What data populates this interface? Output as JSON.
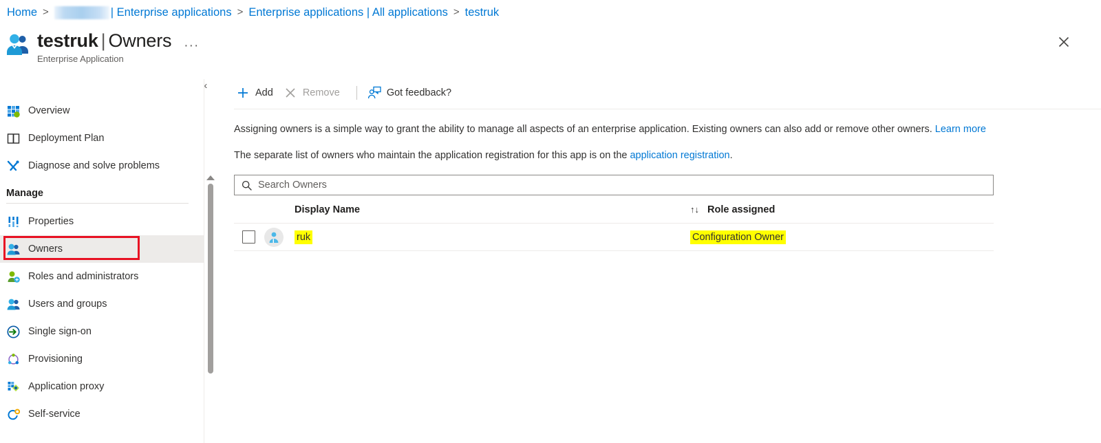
{
  "breadcrumb": {
    "items": [
      {
        "label": "Home",
        "type": "link"
      },
      {
        "label": "",
        "type": "redacted"
      },
      {
        "label": "| Enterprise applications",
        "type": "link"
      },
      {
        "label": "Enterprise applications | All applications",
        "type": "link"
      },
      {
        "label": "testruk",
        "type": "link"
      }
    ],
    "separator": ">"
  },
  "header": {
    "title_main": "testruk",
    "title_bar": "|",
    "title_section": "Owners",
    "subtitle": "Enterprise Application",
    "ellipsis": "···",
    "close_icon": "close-icon",
    "app_icon": "enterprise-application-icon"
  },
  "sidebar": {
    "collapse_icon": "«",
    "items": [
      {
        "label": "Overview",
        "icon": "overview-grid-icon",
        "selected": false
      },
      {
        "label": "Deployment Plan",
        "icon": "book-icon",
        "selected": false
      },
      {
        "label": "Diagnose and solve problems",
        "icon": "wrench-screwdriver-icon",
        "selected": false
      }
    ],
    "section_label": "Manage",
    "manage_items": [
      {
        "label": "Properties",
        "icon": "properties-bars-icon",
        "selected": false
      },
      {
        "label": "Owners",
        "icon": "owners-people-icon",
        "selected": true
      },
      {
        "label": "Roles and administrators",
        "icon": "role-person-icon",
        "selected": false
      },
      {
        "label": "Users and groups",
        "icon": "users-groups-icon",
        "selected": false
      },
      {
        "label": "Single sign-on",
        "icon": "single-sign-on-arrow-icon",
        "selected": false
      },
      {
        "label": "Provisioning",
        "icon": "provisioning-cycle-icon",
        "selected": false
      },
      {
        "label": "Application proxy",
        "icon": "application-proxy-icon",
        "selected": false
      },
      {
        "label": "Self-service",
        "icon": "self-service-icon",
        "selected": false
      }
    ],
    "highlight_color": "#e81123",
    "selected_bg": "#edebe9"
  },
  "toolbar": {
    "add_label": "Add",
    "remove_label": "Remove",
    "feedback_label": "Got feedback?",
    "add_icon": "plus-icon",
    "remove_icon": "cross-icon",
    "feedback_icon": "feedback-person-icon"
  },
  "content": {
    "description_1_part1": "Assigning owners is a simple way to grant the ability to manage all aspects of an enterprise application. Existing owners can also add or remove other owners. ",
    "description_1_link": "Learn more",
    "description_2_part1": "The separate list of owners who maintain the application registration for this app is on the ",
    "description_2_link": "application registration",
    "description_2_part2": ".",
    "search": {
      "placeholder": "Search Owners",
      "value": "",
      "icon": "search-icon"
    },
    "table": {
      "columns": [
        "Display Name",
        "Role assigned"
      ],
      "sort_icon": "↑↓",
      "rows": [
        {
          "checked": false,
          "avatar_icon": "user-avatar-icon",
          "display_name": "ruk",
          "role_assigned": "Configuration Owner",
          "highlighted": true
        }
      ]
    },
    "highlight_color": "#ffff00"
  }
}
